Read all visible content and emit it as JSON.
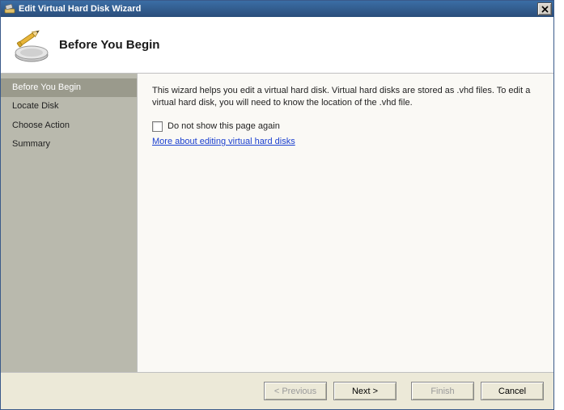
{
  "titlebar": {
    "title": "Edit Virtual Hard Disk Wizard"
  },
  "header": {
    "title": "Before You Begin"
  },
  "sidebar": {
    "items": [
      {
        "label": "Before You Begin",
        "selected": true
      },
      {
        "label": "Locate Disk",
        "selected": false
      },
      {
        "label": "Choose Action",
        "selected": false
      },
      {
        "label": "Summary",
        "selected": false
      }
    ]
  },
  "main": {
    "description": "This wizard helps you edit a virtual hard disk. Virtual hard disks are stored as .vhd files. To edit a virtual hard disk, you will need to know the location of the .vhd file.",
    "checkbox_label": "Do not show this page again",
    "checkbox_checked": false,
    "link_label": "More about editing virtual hard disks"
  },
  "footer": {
    "previous": "< Previous",
    "next": "Next >",
    "finish": "Finish",
    "cancel": "Cancel"
  }
}
